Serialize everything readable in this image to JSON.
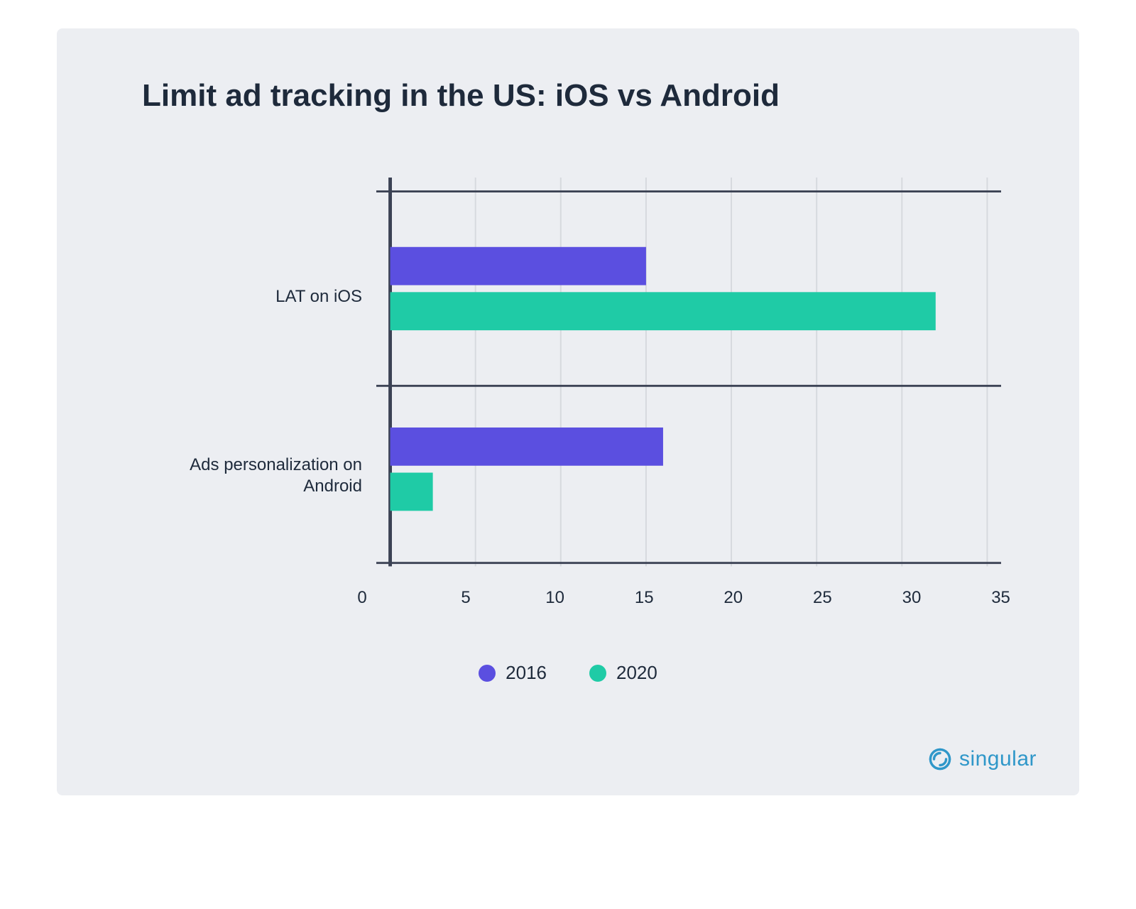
{
  "title": "Limit ad tracking in the US: iOS vs Android",
  "brand": "singular",
  "legend": {
    "a": "2016",
    "b": "2020"
  },
  "xticks": [
    "0",
    "5",
    "10",
    "15",
    "20",
    "25",
    "30",
    "35"
  ],
  "categories": {
    "ios": "LAT on iOS",
    "android": "Ads personalization on Android"
  },
  "chart_data": {
    "type": "bar",
    "orientation": "horizontal",
    "categories": [
      "LAT on iOS",
      "Ads personalization on Android"
    ],
    "series": [
      {
        "name": "2016",
        "values": [
          15,
          16
        ],
        "color": "#5b4fe0"
      },
      {
        "name": "2020",
        "values": [
          32,
          2.5
        ],
        "color": "#1fcba6"
      }
    ],
    "xlabel": "",
    "ylabel": "",
    "xlim": [
      0,
      35
    ],
    "xticks": [
      0,
      5,
      10,
      15,
      20,
      25,
      30,
      35
    ],
    "grid": "vertical",
    "legend_position": "bottom",
    "title": "Limit ad tracking in the US: iOS vs Android"
  }
}
